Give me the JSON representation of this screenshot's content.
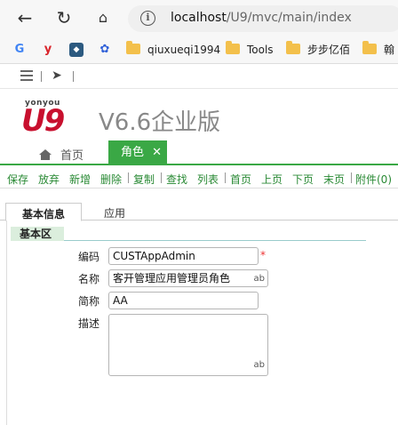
{
  "browser": {
    "url_host": "localhost",
    "url_path": "/U9/mvc/main/index",
    "bookmarks": [
      {
        "label": "qiuxueqi1994"
      },
      {
        "label": "Tools"
      },
      {
        "label": "步步亿佰"
      },
      {
        "label": "翰"
      }
    ]
  },
  "app": {
    "logo_small": "yonyou",
    "logo_brand": "U9",
    "logo_version": "V6.6企业版",
    "tabs": [
      {
        "label": "首页"
      },
      {
        "label": "角色"
      }
    ],
    "actions": [
      "保存",
      "放弃",
      "新增",
      "删除",
      "复制",
      "查找",
      "列表",
      "首页",
      "上页",
      "下页",
      "末页",
      "附件(0)"
    ],
    "form_tabs": [
      "基本信息",
      "应用"
    ],
    "section_label": "基本区",
    "fields": {
      "code_label": "编码",
      "code_value": "CUSTAppAdmin",
      "name_label": "名称",
      "name_value": "客开管理应用管理员角色",
      "short_label": "简称",
      "short_value": "AA",
      "desc_label": "描述",
      "desc_value": "",
      "ab": "ab",
      "required_mark": "*"
    }
  },
  "colors": {
    "accent_green": "#3aa845",
    "brand_red": "#c8102e"
  }
}
